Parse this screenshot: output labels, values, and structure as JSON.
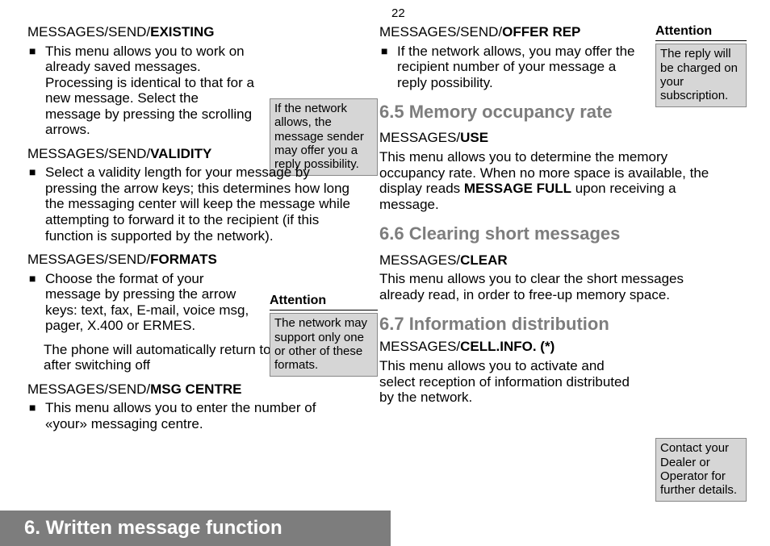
{
  "page_number": "22",
  "section_bar": "6. Written message function",
  "left": {
    "h1": {
      "pre": "MESSAGES/SEND/",
      "b": "EXISTING"
    },
    "p1": "This menu allows you to work on already saved messages. Processing is identical to that for a new message. Select the message by pressing the scrolling arrows.",
    "aside1": "If the network allows, the message sender may offer you a reply possibility.",
    "h2": {
      "pre": "MESSAGES/SEND/",
      "b": "VALIDITY"
    },
    "p2": "Select a validity length for your message by pressing the arrow keys; this determines how long the messaging center will keep the message while attempting to forward it to the recipient (if this function is supported by the network).",
    "h3": {
      "pre": "MESSAGES/SEND/",
      "b": "FORMATS"
    },
    "p3": "Choose the format of your message by pressing the arrow keys: text, fax, E-mail, voice msg, pager, X.400 or ERMES.",
    "aside2_label": "Attention",
    "aside2": "The network may support only one or other of these formats.",
    "p3b": "The phone will automatically return to text format after switching off",
    "h4": {
      "pre": "MESSAGES/SEND/",
      "b": "MSG CENTRE"
    },
    "p4": "This menu allows you to enter the number of «your» messaging centre."
  },
  "right": {
    "h1": {
      "pre": "MESSAGES/SEND/",
      "b": "OFFER REP"
    },
    "p1": "If the network allows, you may offer the recipient number of your message a reply possibility.",
    "side1_label": "Attention",
    "side1": "The reply will be charged on your subscription.",
    "sec65": "6.5 Memory occupancy rate",
    "h65": {
      "pre": "MESSAGES/",
      "b": "USE"
    },
    "p65a": "This menu allows you to determine the memory occupancy rate. When no more space is available, the display reads ",
    "p65b": "MESSAGE FULL",
    "p65c": " upon receiving a message.",
    "sec66": "6.6 Clearing short messages",
    "h66": {
      "pre": "MESSAGES/",
      "b": "CLEAR"
    },
    "p66": "This menu allows you to clear the short messages already read, in order to free-up memory space.",
    "sec67": "6.7 Information distribution",
    "h67": {
      "pre": "MESSAGES/",
      "b": "CELL.INFO. (*)"
    },
    "p67": "This menu allows you to activate and select reception of information distributed by the network.",
    "side2": "Contact your Dealer or Operator for further details."
  }
}
